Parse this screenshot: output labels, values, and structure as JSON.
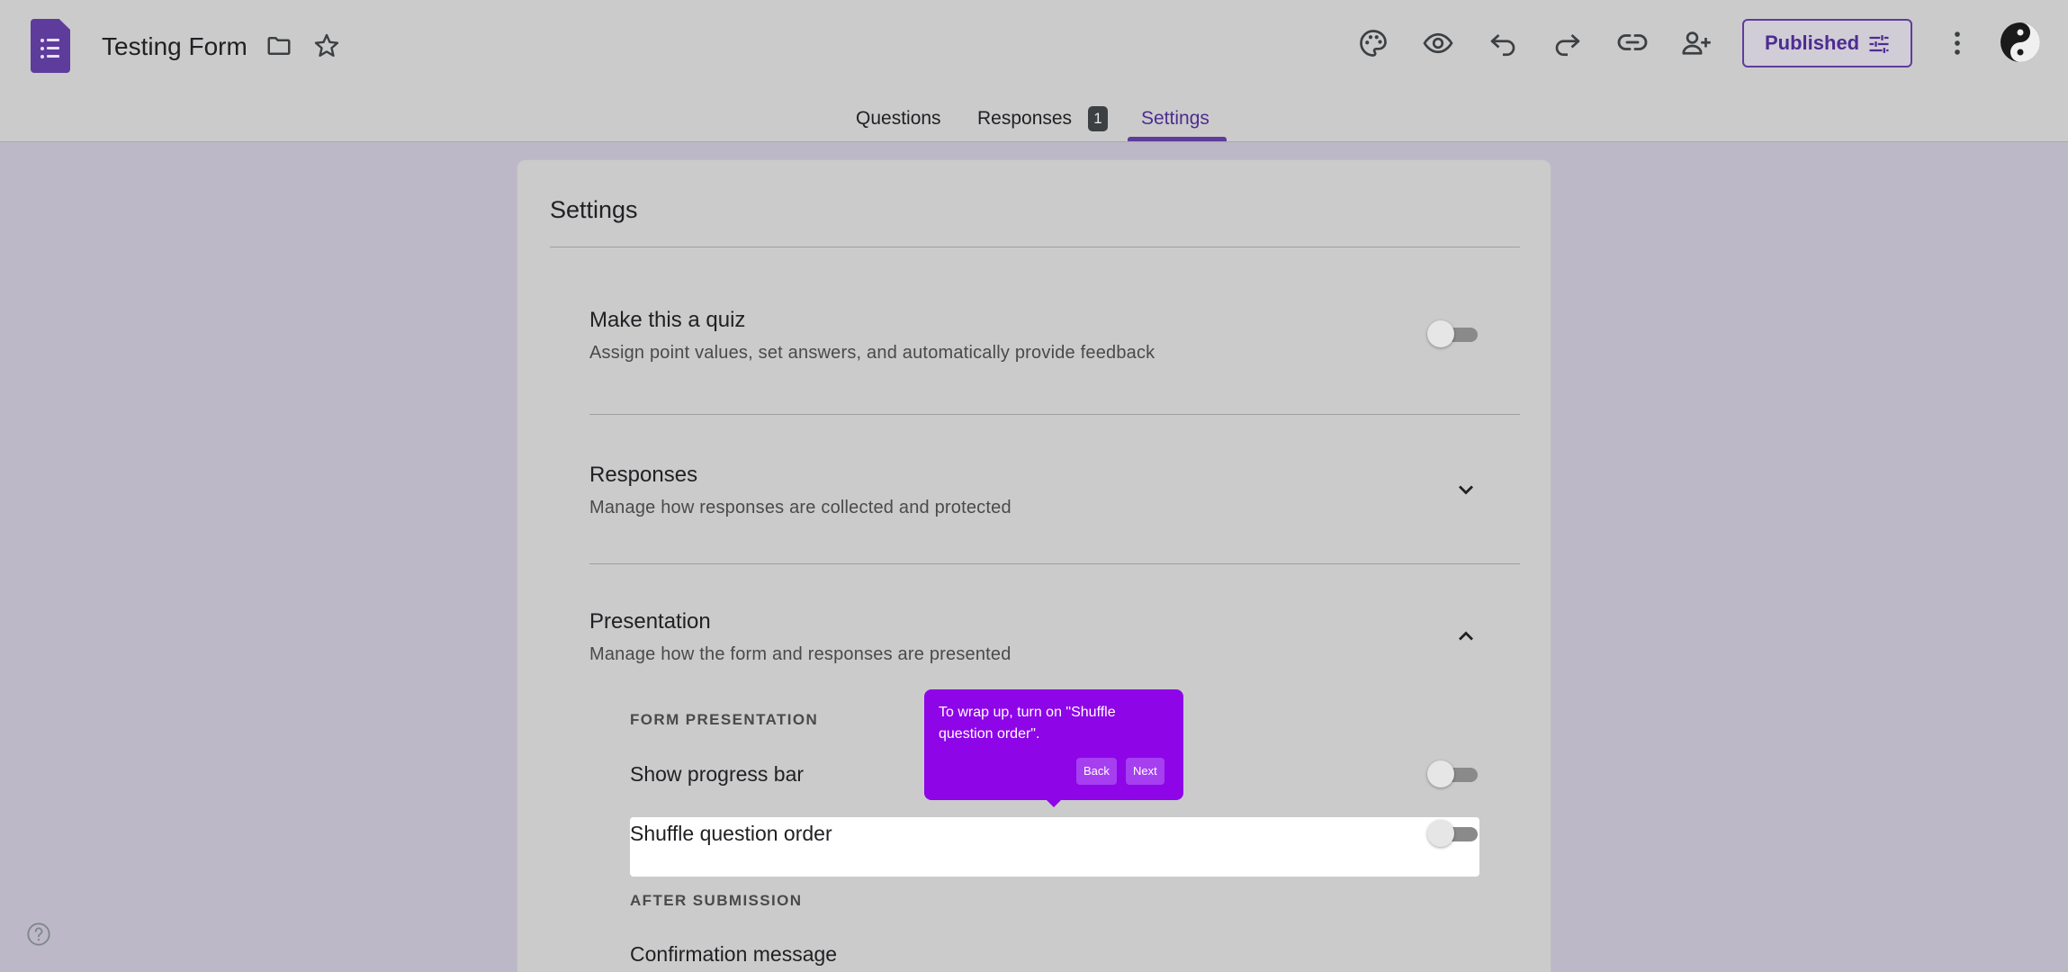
{
  "header": {
    "title": "Testing Form",
    "publish_label": "Published",
    "icons": [
      "forms-app-icon",
      "folder-icon",
      "star-icon",
      "palette-icon",
      "eye-icon",
      "undo-icon",
      "redo-icon",
      "link-icon",
      "add-person-icon",
      "tune-icon",
      "more-vert-icon",
      "avatar"
    ]
  },
  "tabs": [
    {
      "label": "Questions"
    },
    {
      "label": "Responses",
      "badge": "1"
    },
    {
      "label": "Settings",
      "active": true
    }
  ],
  "settings": {
    "title": "Settings",
    "quiz": {
      "title": "Make this a quiz",
      "subtitle": "Assign point values, set answers, and automatically provide feedback",
      "enabled": false
    },
    "responses": {
      "title": "Responses",
      "subtitle": "Manage how responses are collected and protected",
      "expanded": false
    },
    "presentation": {
      "title": "Presentation",
      "subtitle": "Manage how the form and responses are presented",
      "expanded": true,
      "form_presentation_caption": "FORM PRESENTATION",
      "progress_bar": {
        "label": "Show progress bar",
        "enabled": false
      },
      "shuffle": {
        "label": "Shuffle question order",
        "enabled": false
      },
      "after_submission_caption": "AFTER SUBMISSION",
      "confirmation": {
        "label": "Confirmation message"
      }
    }
  },
  "tooltip": {
    "text": "To wrap up, turn on \"Shuffle question order\".",
    "back_label": "Back",
    "next_label": "Next"
  },
  "colors": {
    "accent": "#5e3c9c",
    "tooltip": "#8e05e8",
    "header_bg": "#cbcbcb",
    "page_bg": "#bdb8c7"
  }
}
